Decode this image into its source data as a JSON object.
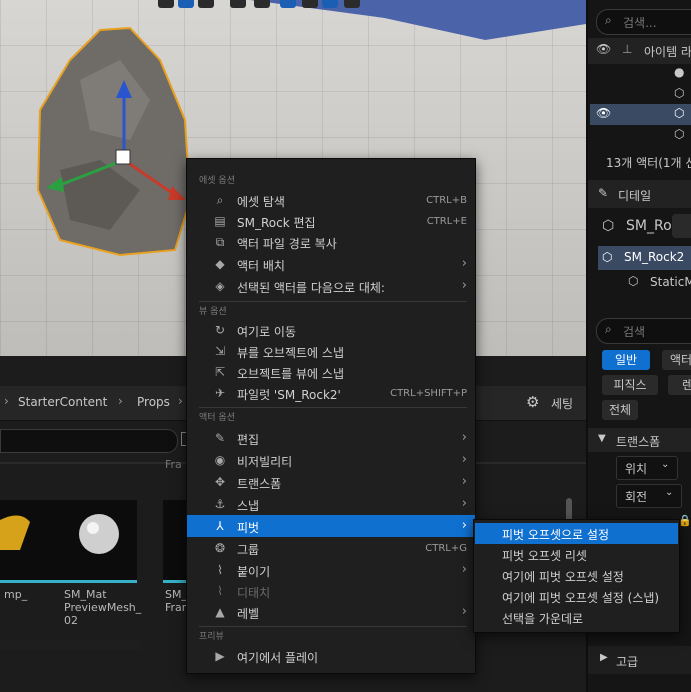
{
  "outliner": {
    "search_placeholder": "검색...",
    "column_label": "아이템 라",
    "actor_count": "13개 액터(1개 선"
  },
  "details": {
    "tab_label": "디테일",
    "actor_name": "SM_Ro",
    "component_name": "SM_Rock2",
    "static_mesh_label": "StaticM",
    "search_placeholder": "검색",
    "filters": [
      "일반",
      "액터",
      "피직스",
      "렌",
      "전체"
    ],
    "transform_label": "트랜스폼",
    "location_label": "위치",
    "rotation_label": "회전",
    "advanced_label": "고급"
  },
  "content_browser": {
    "breadcrumb": [
      "StarterContent",
      "Props"
    ],
    "settings_label": "세팅",
    "thumbnails": [
      {
        "label": "mp_"
      },
      {
        "label": "SM_Mat PreviewMesh_ 02"
      },
      {
        "label": "SM_ Fran"
      }
    ],
    "partial_label": "Fra"
  },
  "context_menu": {
    "sections": [
      {
        "header": "에셋 옵션",
        "items": [
          {
            "icon": "browse-icon",
            "glyph": "⌕",
            "label": "에셋 탐색",
            "shortcut": "CTRL+B"
          },
          {
            "icon": "edit-asset-icon",
            "glyph": "▤",
            "label": "SM_Rock 편집",
            "shortcut": "CTRL+E"
          },
          {
            "icon": "copy-path-icon",
            "glyph": "⧉",
            "label": "액터 파일 경로 복사",
            "shortcut": ""
          },
          {
            "icon": "place-actor-icon",
            "glyph": "◆",
            "label": "액터 배치",
            "submenu": true
          },
          {
            "icon": "replace-actor-icon",
            "glyph": "◈",
            "label": "선택된 액터를 다음으로 대체:",
            "submenu": true
          }
        ]
      },
      {
        "header": "뷰 옵션",
        "items": [
          {
            "icon": "go-here-icon",
            "glyph": "↻",
            "label": "여기로 이동",
            "shortcut": ""
          },
          {
            "icon": "snap-view-icon",
            "glyph": "⇲",
            "label": "뷰를 오브젝트에 스냅",
            "shortcut": ""
          },
          {
            "icon": "snap-object-icon",
            "glyph": "⇱",
            "label": "오브젝트를 뷰에 스냅",
            "shortcut": ""
          },
          {
            "icon": "pilot-icon",
            "glyph": "✈",
            "label": "파일럿 'SM_Rock2'",
            "shortcut": "CTRL+SHIFT+P"
          }
        ]
      },
      {
        "header": "액터 옵션",
        "items": [
          {
            "icon": "edit-icon",
            "glyph": "✎",
            "label": "편집",
            "submenu": true
          },
          {
            "icon": "visibility-icon",
            "glyph": "◉",
            "label": "비저빌리티",
            "submenu": true
          },
          {
            "icon": "transform-icon",
            "glyph": "✥",
            "label": "트랜스폼",
            "submenu": true
          },
          {
            "icon": "snap-icon",
            "glyph": "⚓",
            "label": "스냅",
            "submenu": true
          },
          {
            "icon": "pivot-icon",
            "glyph": "⅄",
            "label": "피벗",
            "submenu": true,
            "highlighted": true
          },
          {
            "icon": "group-icon",
            "glyph": "❂",
            "label": "그룹",
            "shortcut": "CTRL+G"
          },
          {
            "icon": "attach-icon",
            "glyph": "⌇",
            "label": "붙이기",
            "submenu": true
          },
          {
            "icon": "detach-icon",
            "glyph": "⌇",
            "label": "디태치",
            "disabled": true
          },
          {
            "icon": "level-icon",
            "glyph": "▲",
            "label": "레벨",
            "submenu": true
          }
        ]
      },
      {
        "header": "프리뷰",
        "items": [
          {
            "icon": "play-icon",
            "glyph": "▶",
            "label": "여기에서 플레이",
            "shortcut": ""
          }
        ]
      }
    ]
  },
  "pivot_submenu": {
    "items": [
      {
        "label": "피벗 오프셋으로 설정",
        "highlighted": true
      },
      {
        "label": "피벗 오프셋 리셋"
      },
      {
        "label": "여기에 피벗 오프셋 설정"
      },
      {
        "label": "여기에 피벗 오프셋 설정 (스냅)"
      },
      {
        "label": "선택을 가운데로"
      }
    ]
  }
}
